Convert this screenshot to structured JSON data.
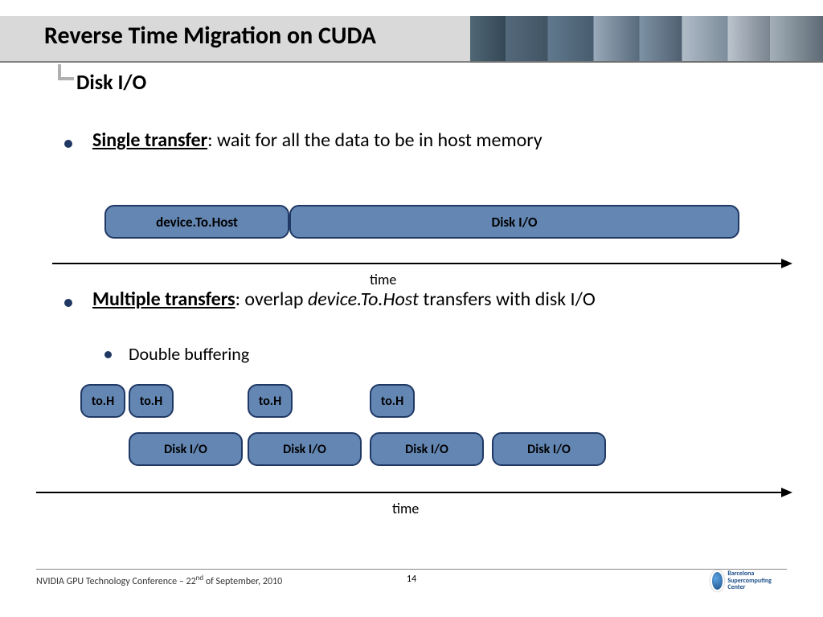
{
  "title": "Reverse Time Migration on CUDA",
  "subtitle": "Disk I/O",
  "bullet1": {
    "bold": "Single transfer",
    "rest": ": wait for all the data to be in host memory"
  },
  "diag1": {
    "pillA": "device.To.Host",
    "pillB": "Disk I/O",
    "time": "time"
  },
  "bullet2": {
    "bold": "Multiple transfers",
    "segA": ": overlap ",
    "ital": "device.To.Host",
    "segB": " transfers with disk I/O"
  },
  "subbullet": "Double buffering",
  "diag2": {
    "toH": "to.H",
    "disk": "Disk I/O",
    "time": "time"
  },
  "footer": {
    "conf_pre": "NVIDIA GPU Technology Conference – 22",
    "conf_sup": "nd",
    "conf_post": " of September, 2010",
    "page": "14",
    "logo_text": "Barcelona Supercomputing Center"
  }
}
